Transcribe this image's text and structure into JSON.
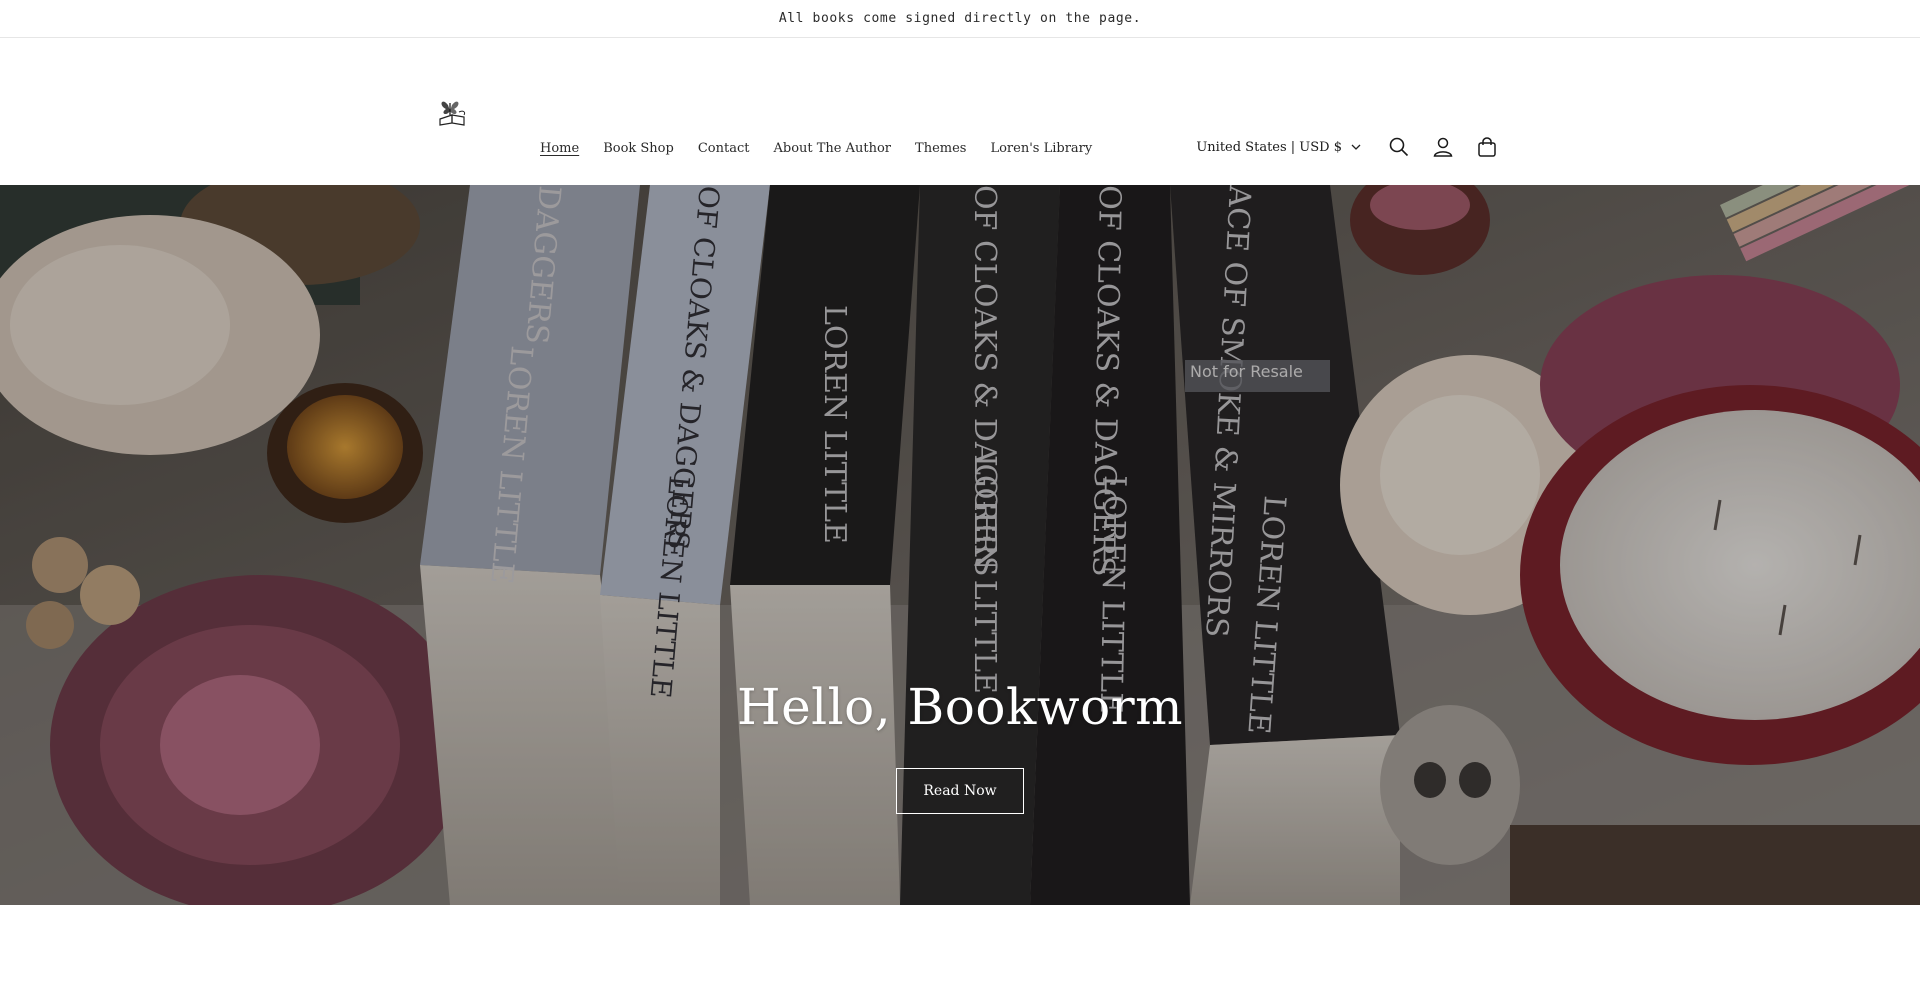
{
  "announcement": {
    "text": "All books come signed directly on the page."
  },
  "header": {
    "logo_icon": "butterfly-book-logo",
    "nav": [
      {
        "label": "Home",
        "active": true
      },
      {
        "label": "Book Shop",
        "active": false
      },
      {
        "label": "Contact",
        "active": false
      },
      {
        "label": "About The Author",
        "active": false
      },
      {
        "label": "Themes",
        "active": false
      },
      {
        "label": "Loren's Library",
        "active": false
      }
    ],
    "currency": {
      "label": "United States | USD $",
      "icon": "chevron-down-icon"
    },
    "icons": {
      "search": "search-icon",
      "account": "account-icon",
      "cart": "cart-icon"
    }
  },
  "hero": {
    "title": "Hello, Bookworm",
    "button_label": "Read Now",
    "image": {
      "description": "Stack of books on a table with flowers, candles and a skull",
      "spine_texts": [
        "DAGGERS",
        "LOREN LITTLE",
        "OF CLOAKS & DAGGERS",
        "LOREN LITTLE",
        "LOREN LITTLE",
        "OF CLOAKS & DAGGERS",
        "LOREN LITTLE",
        "OF CLOAKS & DAGGERS",
        "LOREN LITTLE",
        "ACE OF SMOKE & MIRRORS",
        "LOREN LITTLE",
        "Not for Resale"
      ]
    }
  },
  "below": {
    "heading": ""
  }
}
